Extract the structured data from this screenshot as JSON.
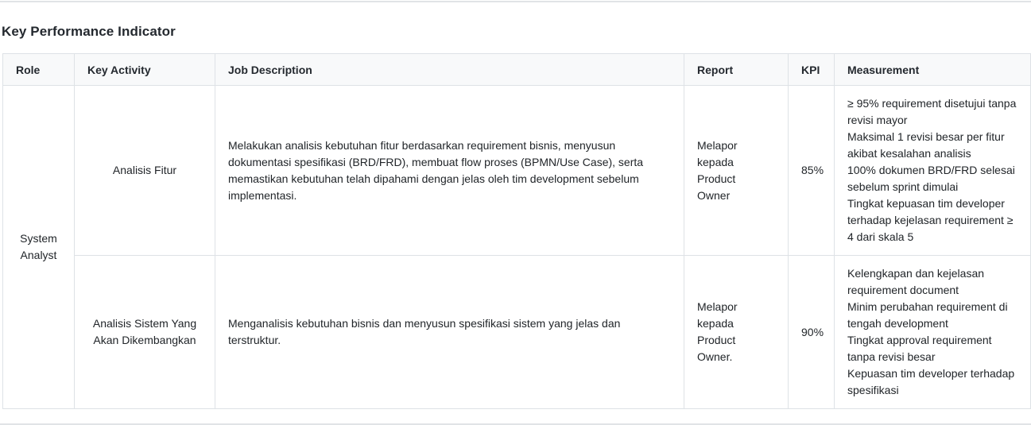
{
  "page": {
    "title": "Key Performance Indicator"
  },
  "colors": {
    "header_bg": "#f8f9fa",
    "border": "#dee2e6",
    "text": "#212529",
    "divider": "#e1e3e6"
  },
  "table": {
    "headers": [
      "Role",
      "Key Activity",
      "Job Description",
      "Report",
      "KPI",
      "Measurement"
    ],
    "role": "System Analyst",
    "rows": [
      {
        "key_activity": "Analisis Fitur",
        "job_description": "Melakukan analisis kebutuhan fitur berdasarkan requirement bisnis, menyusun dokumentasi spesifikasi (BRD/FRD), membuat flow proses (BPMN/Use Case), serta memastikan kebutuhan telah dipahami dengan jelas oleh tim development sebelum implementasi.",
        "report": "Melapor\nkepada Product\nOwner",
        "kpi": "85%",
        "measurement": [
          "≥ 95% requirement disetujui tanpa revisi mayor",
          "Maksimal 1 revisi besar per fitur akibat kesalahan analisis",
          "100% dokumen BRD/FRD selesai sebelum sprint dimulai",
          "Tingkat kepuasan tim developer terhadap kejelasan requirement ≥ 4 dari skala 5"
        ]
      },
      {
        "key_activity": "Analisis Sistem Yang Akan Dikembangkan",
        "job_description": "Menganalisis kebutuhan bisnis dan menyusun spesifikasi sistem yang jelas dan terstruktur.",
        "report": "Melapor\nkepada Product\nOwner.",
        "kpi": "90%",
        "measurement": [
          "Kelengkapan dan kejelasan requirement document",
          "Minim perubahan requirement di tengah development",
          "Tingkat approval requirement tanpa revisi besar",
          "Kepuasan tim developer terhadap spesifikasi"
        ]
      }
    ]
  }
}
